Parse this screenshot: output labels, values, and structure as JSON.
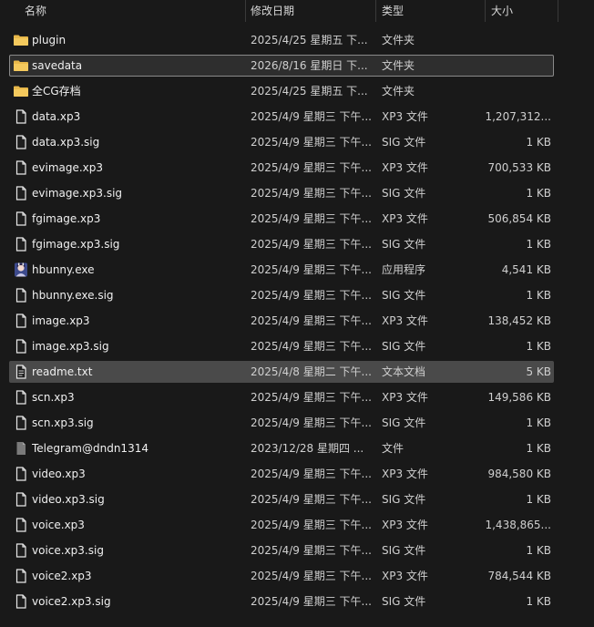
{
  "header": {
    "name": "名称",
    "date": "修改日期",
    "type": "类型",
    "size": "大小",
    "sort_arrow": "^"
  },
  "colors": {
    "background": "#191919",
    "folder": "#e8b84a",
    "selected": "#4a4a4a",
    "text": "#f0f0f0"
  },
  "files": [
    {
      "name": "plugin",
      "date": "2025/4/25 星期五 下...",
      "type": "文件夹",
      "size": "",
      "icon": "folder-icon",
      "state": ""
    },
    {
      "name": "savedata",
      "date": "2026/8/16 星期日 下...",
      "type": "文件夹",
      "size": "",
      "icon": "folder-icon",
      "state": "focused"
    },
    {
      "name": "全CG存档",
      "date": "2025/4/25 星期五 下...",
      "type": "文件夹",
      "size": "",
      "icon": "folder-icon",
      "state": ""
    },
    {
      "name": "data.xp3",
      "date": "2025/4/9 星期三 下午...",
      "type": "XP3 文件",
      "size": "1,207,312...",
      "icon": "file-icon",
      "state": ""
    },
    {
      "name": "data.xp3.sig",
      "date": "2025/4/9 星期三 下午...",
      "type": "SIG 文件",
      "size": "1 KB",
      "icon": "file-icon",
      "state": ""
    },
    {
      "name": "evimage.xp3",
      "date": "2025/4/9 星期三 下午...",
      "type": "XP3 文件",
      "size": "700,533 KB",
      "icon": "file-icon",
      "state": ""
    },
    {
      "name": "evimage.xp3.sig",
      "date": "2025/4/9 星期三 下午...",
      "type": "SIG 文件",
      "size": "1 KB",
      "icon": "file-icon",
      "state": ""
    },
    {
      "name": "fgimage.xp3",
      "date": "2025/4/9 星期三 下午...",
      "type": "XP3 文件",
      "size": "506,854 KB",
      "icon": "file-icon",
      "state": ""
    },
    {
      "name": "fgimage.xp3.sig",
      "date": "2025/4/9 星期三 下午...",
      "type": "SIG 文件",
      "size": "1 KB",
      "icon": "file-icon",
      "state": ""
    },
    {
      "name": "hbunny.exe",
      "date": "2025/4/9 星期三 下午...",
      "type": "应用程序",
      "size": "4,541 KB",
      "icon": "app-icon",
      "state": ""
    },
    {
      "name": "hbunny.exe.sig",
      "date": "2025/4/9 星期三 下午...",
      "type": "SIG 文件",
      "size": "1 KB",
      "icon": "file-icon",
      "state": ""
    },
    {
      "name": "image.xp3",
      "date": "2025/4/9 星期三 下午...",
      "type": "XP3 文件",
      "size": "138,452 KB",
      "icon": "file-icon",
      "state": ""
    },
    {
      "name": "image.xp3.sig",
      "date": "2025/4/9 星期三 下午...",
      "type": "SIG 文件",
      "size": "1 KB",
      "icon": "file-icon",
      "state": ""
    },
    {
      "name": "readme.txt",
      "date": "2025/4/8 星期二 下午...",
      "type": "文本文档",
      "size": "5 KB",
      "icon": "text-file-icon",
      "state": "selected"
    },
    {
      "name": "scn.xp3",
      "date": "2025/4/9 星期三 下午...",
      "type": "XP3 文件",
      "size": "149,586 KB",
      "icon": "file-icon",
      "state": ""
    },
    {
      "name": "scn.xp3.sig",
      "date": "2025/4/9 星期三 下午...",
      "type": "SIG 文件",
      "size": "1 KB",
      "icon": "file-icon",
      "state": ""
    },
    {
      "name": "Telegram@dndn1314",
      "date": "2023/12/28 星期四 ...",
      "type": "文件",
      "size": "1 KB",
      "icon": "blank-file-icon",
      "state": ""
    },
    {
      "name": "video.xp3",
      "date": "2025/4/9 星期三 下午...",
      "type": "XP3 文件",
      "size": "984,580 KB",
      "icon": "file-icon",
      "state": ""
    },
    {
      "name": "video.xp3.sig",
      "date": "2025/4/9 星期三 下午...",
      "type": "SIG 文件",
      "size": "1 KB",
      "icon": "file-icon",
      "state": ""
    },
    {
      "name": "voice.xp3",
      "date": "2025/4/9 星期三 下午...",
      "type": "XP3 文件",
      "size": "1,438,865...",
      "icon": "file-icon",
      "state": ""
    },
    {
      "name": "voice.xp3.sig",
      "date": "2025/4/9 星期三 下午...",
      "type": "SIG 文件",
      "size": "1 KB",
      "icon": "file-icon",
      "state": ""
    },
    {
      "name": "voice2.xp3",
      "date": "2025/4/9 星期三 下午...",
      "type": "XP3 文件",
      "size": "784,544 KB",
      "icon": "file-icon",
      "state": ""
    },
    {
      "name": "voice2.xp3.sig",
      "date": "2025/4/9 星期三 下午...",
      "type": "SIG 文件",
      "size": "1 KB",
      "icon": "file-icon",
      "state": ""
    }
  ]
}
